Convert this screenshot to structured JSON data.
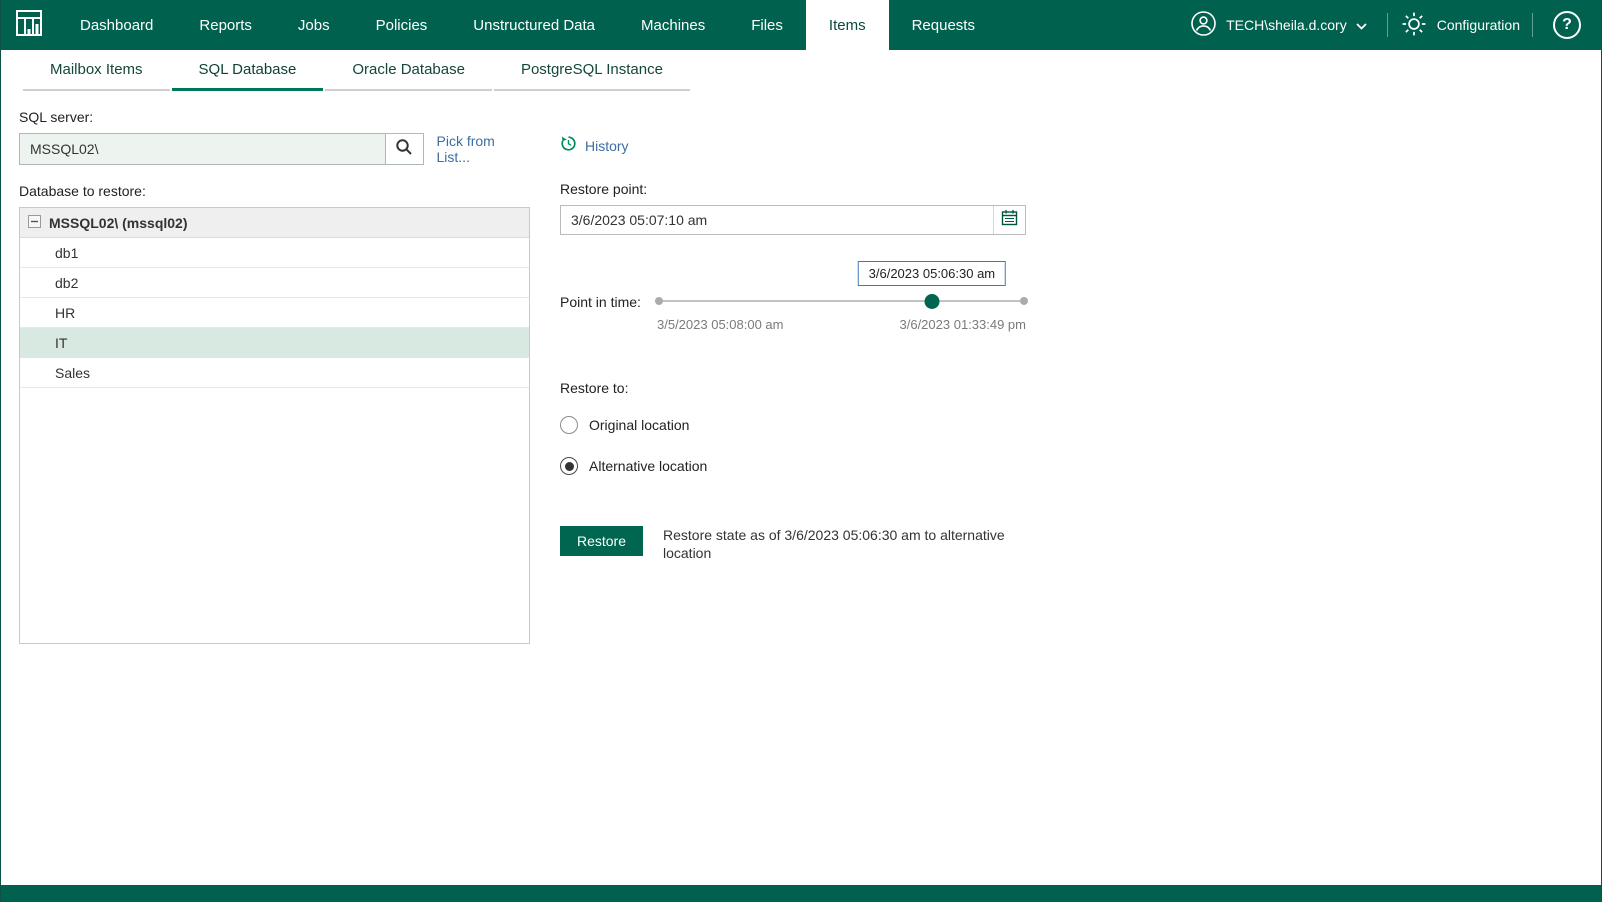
{
  "colors": {
    "header_bg": "#00614e",
    "accent_green": "#00664f",
    "tab_underline": "#00775a",
    "selected_row_bg": "#d7e9e1",
    "link_blue": "#3c6e9f",
    "tooltip_border": "#3d7ab8"
  },
  "nav": {
    "items": [
      {
        "label": "Dashboard"
      },
      {
        "label": "Reports"
      },
      {
        "label": "Jobs"
      },
      {
        "label": "Policies"
      },
      {
        "label": "Unstructured Data"
      },
      {
        "label": "Machines"
      },
      {
        "label": "Files"
      },
      {
        "label": "Items",
        "active": true
      },
      {
        "label": "Requests"
      }
    ],
    "user_label": "TECH\\sheila.d.cory",
    "configuration_label": "Configuration",
    "help_label": "?"
  },
  "tabs": {
    "items": [
      {
        "label": "Mailbox Items"
      },
      {
        "label": "SQL Database",
        "active": true
      },
      {
        "label": "Oracle Database"
      },
      {
        "label": "PostgreSQL Instance"
      }
    ]
  },
  "sql_server": {
    "label": "SQL server:",
    "value": "MSSQL02\\",
    "pick_from_list_label": "Pick from List...",
    "history_label": "History"
  },
  "database_list": {
    "label": "Database to restore:",
    "server_node_label": "MSSQL02\\ (mssql02)",
    "items": [
      {
        "name": "db1"
      },
      {
        "name": "db2"
      },
      {
        "name": "HR"
      },
      {
        "name": "IT",
        "selected": true
      },
      {
        "name": "Sales"
      }
    ]
  },
  "restore_point": {
    "label": "Restore point:",
    "value": "3/6/2023 05:07:10 am"
  },
  "point_in_time": {
    "label": "Point in time:",
    "tooltip": "3/6/2023 05:06:30 am",
    "range_start": "3/5/2023 05:08:00 am",
    "range_end": "3/6/2023 01:33:49 pm",
    "position_pct": 74.5
  },
  "restore_to": {
    "label": "Restore to:",
    "options": [
      {
        "label": "Original location",
        "selected": false
      },
      {
        "label": "Alternative location",
        "selected": true
      }
    ]
  },
  "restore_action": {
    "button_label": "Restore",
    "description": "Restore state as of 3/6/2023 05:06:30 am to alternative location"
  }
}
